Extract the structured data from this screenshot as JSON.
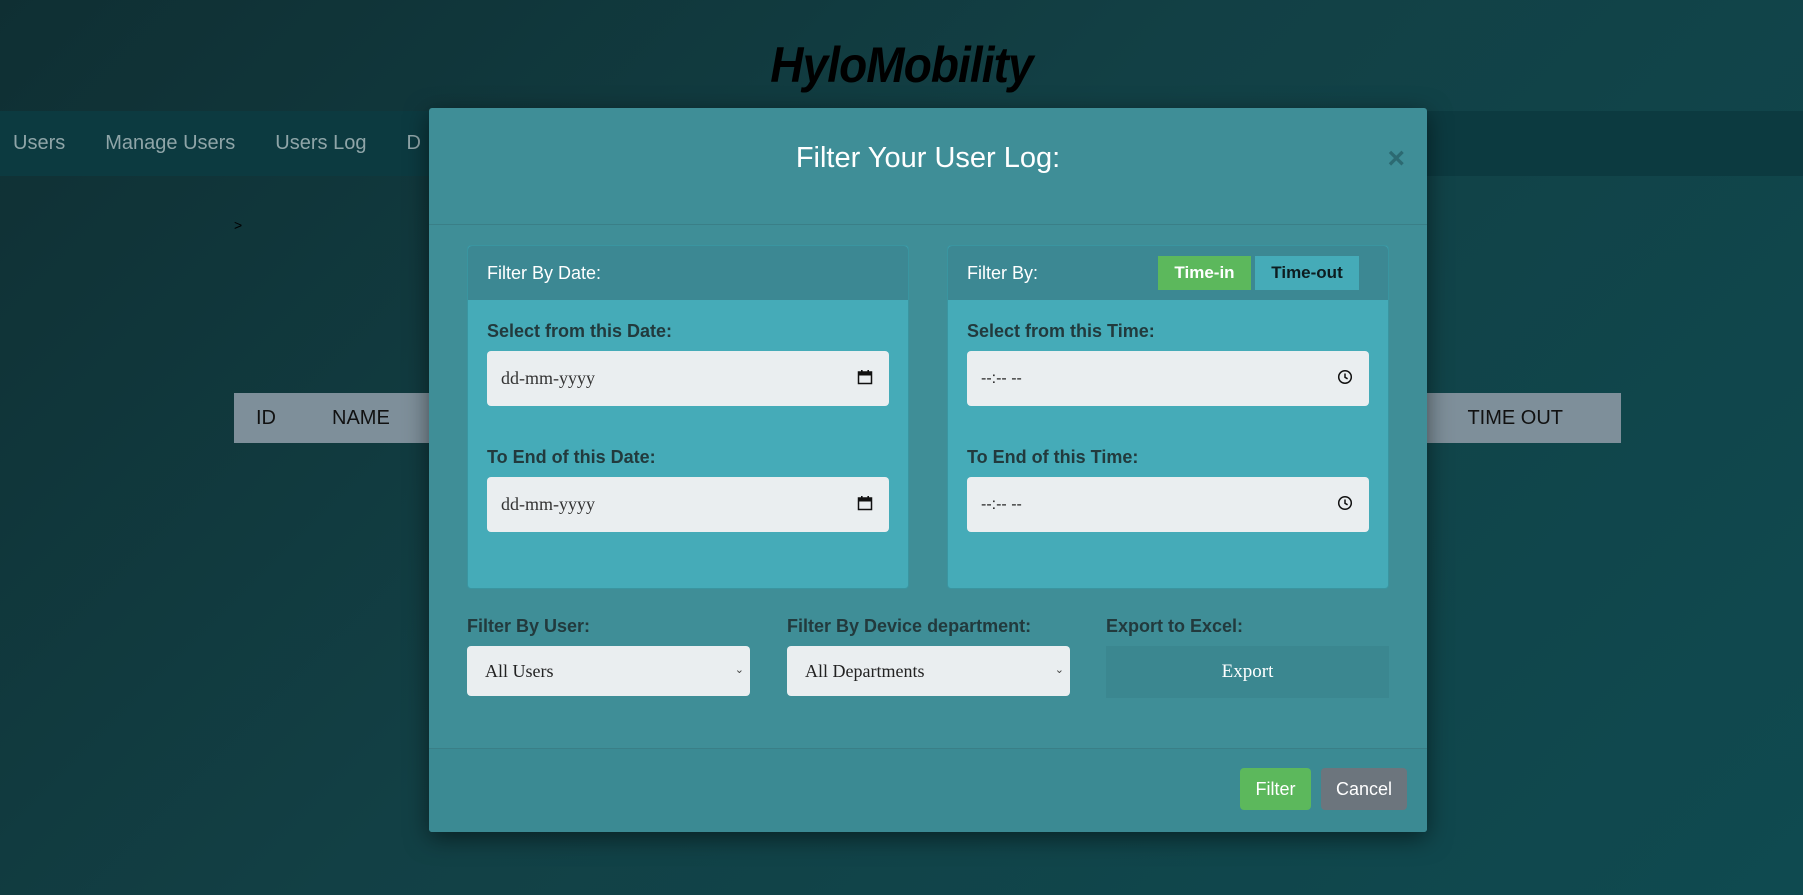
{
  "app": {
    "brand": "HyloMobility"
  },
  "nav": {
    "items": [
      "Users",
      "Manage Users",
      "Users Log",
      "D"
    ]
  },
  "breadcrumb": ">",
  "table": {
    "headers": {
      "id": "ID",
      "name": "NAME",
      "time_out": "TIME OUT"
    }
  },
  "modal": {
    "title": "Filter Your User Log:",
    "close": "×",
    "date_card": {
      "title": "Filter By Date:",
      "from_label": "Select from this Date:",
      "from_placeholder": "dd-mm-yyyy",
      "to_label": "To End of this Date:",
      "to_placeholder": "dd-mm-yyyy"
    },
    "time_card": {
      "title": "Filter By:",
      "toggle_in": "Time-in",
      "toggle_out": "Time-out",
      "active_toggle": "Time-in",
      "from_label": "Select from this Time:",
      "from_placeholder": "--:-- --",
      "to_label": "To End of this Time:",
      "to_placeholder": "--:-- --"
    },
    "user_filter": {
      "label": "Filter By User:",
      "selected": "All Users"
    },
    "dept_filter": {
      "label": "Filter By Device department:",
      "selected": "All Departments"
    },
    "export": {
      "label": "Export to Excel:",
      "button": "Export"
    },
    "footer": {
      "filter_button": "Filter",
      "cancel_button": "Cancel"
    }
  },
  "colors": {
    "modal_bg": "#3f8e97",
    "card_bg": "#45abb8",
    "success": "#5cb85c",
    "secondary": "#6c757d"
  },
  "icons": {
    "date": "calendar-icon",
    "time": "clock-icon",
    "close": "close-icon",
    "select": "chevron-down-icon"
  }
}
